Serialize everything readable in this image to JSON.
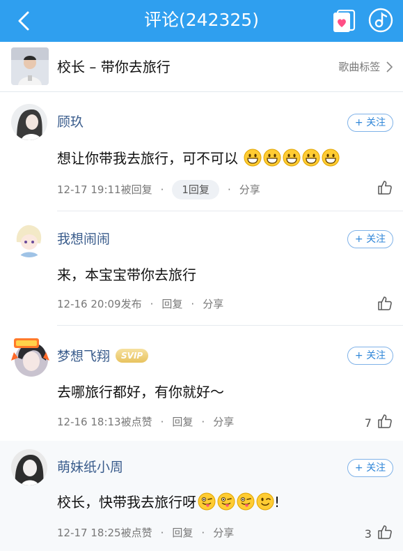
{
  "header": {
    "title": "评论(242325)",
    "back_icon": "back-chevron-icon",
    "card_icon": "heart-card-icon",
    "music_icon": "music-note-icon",
    "color": "#2f9fef"
  },
  "song": {
    "title": "校长 – 带你去旅行",
    "tag_label": "歌曲标签",
    "tag_icon": "chevron-right-icon"
  },
  "comments": [
    {
      "user": "顾玖",
      "follow_label": "+ 关注",
      "text": "想让你带我去旅行，可不可以",
      "emojis": [
        "grin",
        "grin",
        "grin",
        "grin",
        "grin"
      ],
      "time": "12-17 19:11",
      "status": "被回复",
      "reply_label": "1回复",
      "share_label": "分享",
      "likes": ""
    },
    {
      "user": "我想闹闹",
      "follow_label": "+ 关注",
      "text": "来，本宝宝带你去旅行",
      "time": "12-16 20:09",
      "status": "发布",
      "reply_label": "回复",
      "share_label": "分享",
      "likes": ""
    },
    {
      "user": "梦想飞翔",
      "badge": "SVIP",
      "follow_label": "+ 关注",
      "text": "去哪旅行都好，有你就好～",
      "time": "12-16 18:13",
      "status": "被点赞",
      "reply_label": "回复",
      "share_label": "分享",
      "likes": "7"
    },
    {
      "user": "萌妹纸小周",
      "follow_label": "+ 关注",
      "text": "校长，快带我去旅行呀",
      "text_suffix": "!",
      "emojis": [
        "tongue",
        "tongue",
        "tongue",
        "wink"
      ],
      "time": "12-17 18:25",
      "status": "被点赞",
      "reply_label": "回复",
      "share_label": "分享",
      "likes": "3"
    }
  ]
}
